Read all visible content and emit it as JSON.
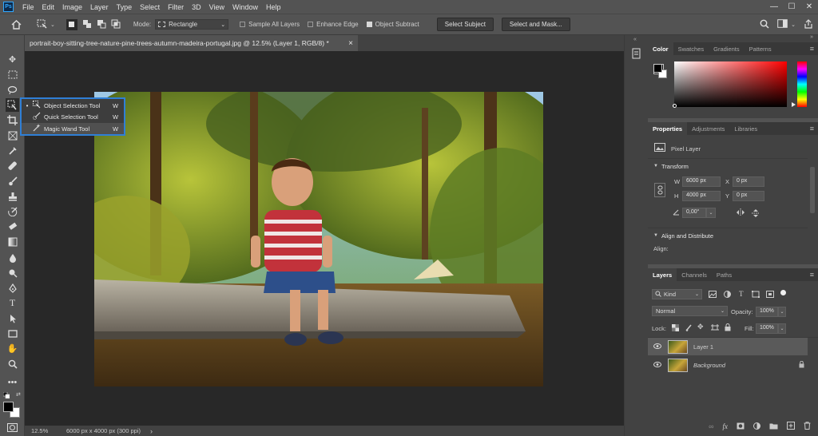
{
  "menubar": {
    "logo": "Ps",
    "items": [
      "File",
      "Edit",
      "Image",
      "Layer",
      "Type",
      "Select",
      "Filter",
      "3D",
      "View",
      "Window",
      "Help"
    ],
    "window_controls": [
      "—",
      "☐",
      "✕"
    ]
  },
  "options": {
    "mode_label": "Mode:",
    "mode_value": "Rectangle",
    "sample_all_layers": "Sample All Layers",
    "enhance_edge": "Enhance Edge",
    "object_subtract": "Object Subtract",
    "select_subject": "Select Subject",
    "select_and_mask": "Select and Mask..."
  },
  "document": {
    "tab_title": "portrait-boy-sitting-tree-nature-pine-trees-autumn-madeira-portugal.jpg @ 12.5% (Layer 1, RGB/8) *",
    "tab_close": "×"
  },
  "flyout": {
    "items": [
      {
        "label": "Object Selection Tool",
        "shortcut": "W",
        "active": true
      },
      {
        "label": "Quick Selection Tool",
        "shortcut": "W",
        "active": false
      },
      {
        "label": "Magic Wand Tool",
        "shortcut": "W",
        "active": false
      }
    ]
  },
  "status": {
    "zoom": "12.5%",
    "info": "6000 px x 4000 px (300 ppi)",
    "arrow": "›"
  },
  "color_panel": {
    "tabs": [
      "Color",
      "Swatches",
      "Gradients",
      "Patterns"
    ],
    "hue_top": "#ff0000",
    "menu": "≡"
  },
  "properties": {
    "tabs": [
      "Properties",
      "Adjustments",
      "Libraries"
    ],
    "layer_type": "Pixel Layer",
    "transform_heading": "Transform",
    "w_label": "W",
    "w_value": "6000 px",
    "h_label": "H",
    "h_value": "4000 px",
    "x_label": "X",
    "x_value": "0 px",
    "y_label": "Y",
    "y_value": "0 px",
    "angle_value": "0,00°",
    "align_heading": "Align and Distribute",
    "align_label": "Align:"
  },
  "layers": {
    "tabs": [
      "Layers",
      "Channels",
      "Paths"
    ],
    "kind": "Kind",
    "blend_mode": "Normal",
    "opacity_label": "Opacity:",
    "opacity_value": "100%",
    "lock_label": "Lock:",
    "fill_label": "Fill:",
    "fill_value": "100%",
    "rows": [
      {
        "name": "Layer 1",
        "selected": true
      },
      {
        "name": "Background",
        "selected": false,
        "locked": true
      }
    ]
  }
}
